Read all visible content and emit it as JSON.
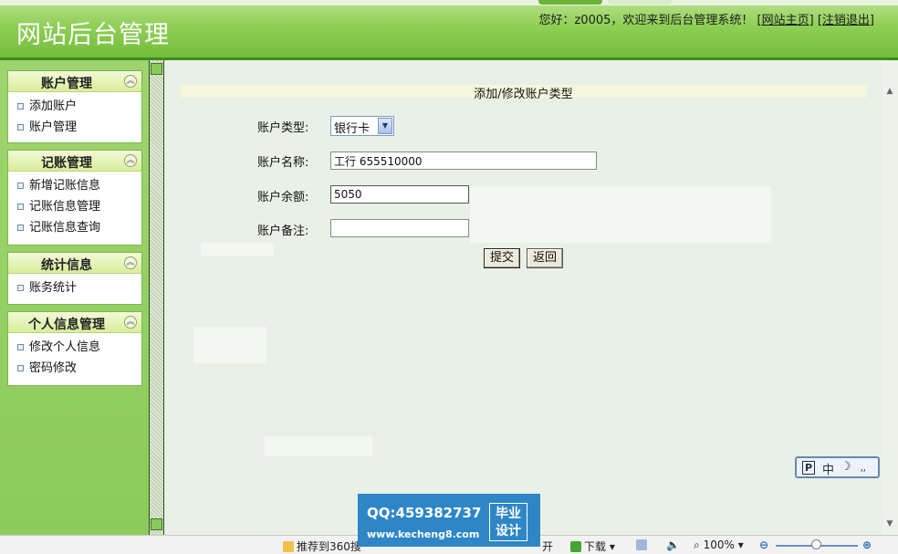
{
  "header": {
    "site_title": "网站后台管理",
    "welcome_text": "您好：z0005，欢迎来到后台管理系统！",
    "home_link": "[网站主页]",
    "logout_link": "[注销退出]"
  },
  "sidebar": {
    "panels": [
      {
        "title": "账户管理",
        "items": [
          "添加账户",
          "账户管理"
        ]
      },
      {
        "title": "记账管理",
        "items": [
          "新增记账信息",
          "记账信息管理",
          "记账信息查询"
        ]
      },
      {
        "title": "统计信息",
        "items": [
          "账务统计"
        ]
      },
      {
        "title": "个人信息管理",
        "items": [
          "修改个人信息",
          "密码修改"
        ]
      }
    ]
  },
  "form": {
    "heading": "添加/修改账户类型",
    "type_label": "账户类型:",
    "type_value": "银行卡",
    "name_label": "账户名称:",
    "name_value": "工行 655510000",
    "balance_label": "账户余额:",
    "balance_value": "5050",
    "note_label": "账户备注:",
    "note_value": "",
    "submit_label": "提交",
    "back_label": "返回"
  },
  "ime": {
    "brand": "P",
    "lang": "中"
  },
  "statusbar": {
    "recommend": "推荐到360搜",
    "open": "开",
    "download": "下载",
    "zoom": "100%"
  },
  "watermark": {
    "qq": "QQ:459382737",
    "url": "www.kecheng8.com",
    "badge_line1": "毕业",
    "badge_line2": "设计"
  }
}
